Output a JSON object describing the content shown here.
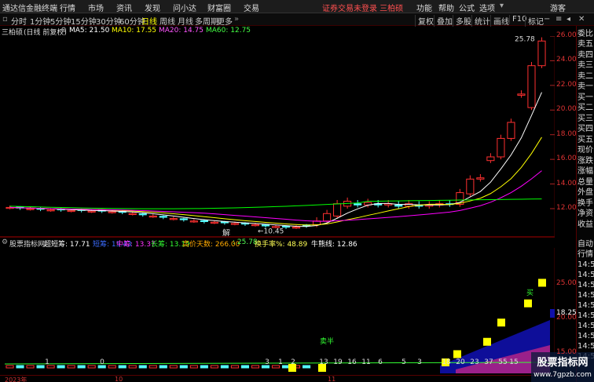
{
  "titlebar": {
    "app_name": "通达信金融终端",
    "menu": [
      "行情",
      "市场",
      "资讯",
      "发现",
      "问小达",
      "财富圈",
      "交易"
    ],
    "notice": "证券交易未登录  三柏硕",
    "right_menu": [
      "功能",
      "帮助",
      "公式",
      "选项"
    ],
    "user": "游客",
    "icon": "dropdown-icon"
  },
  "toolbar": {
    "periods": [
      "分时",
      "1分钟",
      "5分钟",
      "15分钟",
      "30分钟",
      "60分钟",
      "日线",
      "周线",
      "月线",
      "多周期",
      "更多"
    ],
    "active_period": "日线",
    "right": [
      "复权",
      "叠加",
      "多股",
      "统计",
      "画线",
      "F10",
      "标记"
    ]
  },
  "main": {
    "stock": "三柏硕",
    "mode": "(日线 前复权)",
    "ma5": "MA5: 21.50",
    "ma10": "MA10: 17.55",
    "ma20": "MA20: 14.75",
    "ma60": "MA60: 12.75",
    "high_label": "25.78",
    "low_label": "10.45",
    "marker": "解",
    "colors": {
      "ma5": "#ffffff",
      "ma10": "#ffff00",
      "ma20": "#ff00ff",
      "ma60": "#00ff00",
      "up": "#ff3030",
      "down": "#54fcfc"
    }
  },
  "sub": {
    "name": "股票指标网",
    "items": [
      {
        "label": "超短筹: 17.71",
        "color": "#ffffff"
      },
      {
        "label": "短筹: 15.43",
        "color": "#3b6cff"
      },
      {
        "label": "中筹: 13.37",
        "color": "#ff33ff"
      },
      {
        "label": "长筹: 13.19",
        "color": "#33ff33"
      },
      {
        "label": "高价天数: 266.00",
        "color": "#ffaa00"
      },
      {
        "label": ": 25.78",
        "color": "#55ff55"
      },
      {
        "label": "换手率%: 48.89",
        "color": "#ffff55"
      },
      {
        "label": "牛熊线: 12.86",
        "color": "#ffffff"
      }
    ],
    "signal_labels": [
      "卖半",
      "买"
    ],
    "bar_values": [
      "1",
      "0",
      "3",
      "1",
      "2",
      "13",
      "19",
      "16",
      "11",
      "6",
      "5",
      "3",
      "18",
      "20",
      "23",
      "37",
      "55",
      "15"
    ]
  },
  "yaxis_main": [
    "26.00",
    "24.00",
    "22.00",
    "20.00",
    "18.00",
    "16.00",
    "14.00",
    "12.00"
  ],
  "yaxis_sub": [
    "25.00",
    "20.00",
    "15.00"
  ],
  "sub_value": "18.25",
  "xaxis": [
    "2023年",
    "10",
    "11"
  ],
  "right_panel": {
    "top_label": "委比",
    "items": [
      "卖五",
      "卖四",
      "卖三",
      "卖二",
      "卖一",
      "买一",
      "买二",
      "买三",
      "买四",
      "买五",
      "现价",
      "涨跌",
      "涨幅",
      "总量",
      "外盘",
      "换手",
      "净资",
      "收益"
    ],
    "auto": "自动",
    "quote": "行情",
    "times": [
      "14:5",
      "14:5",
      "14:5",
      "14:5",
      "14:5",
      "14:5",
      "14:5",
      "14:5",
      "14:5",
      "14:5"
    ]
  },
  "watermark": {
    "line1": "股票指标网",
    "line2": "www.7gpzb.com"
  }
}
